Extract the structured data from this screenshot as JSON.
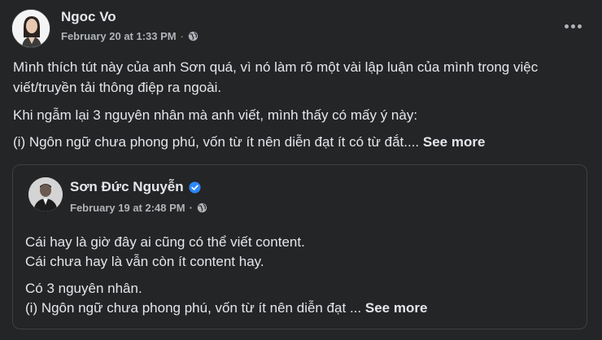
{
  "post": {
    "author": "Ngoc Vo",
    "date": "February 20 at 1:33 PM",
    "separator": "·",
    "privacy_icon": "globe-icon",
    "menu_icon": "more-horizontal-icon",
    "paragraphs": [
      "Mình thích tút này của anh Sơn quá, vì nó làm rõ một vài lập luận của mình trong việc viết/truyền tải thông điệp ra ngoài.",
      "Khi ngẫm lại 3 nguyên nhân mà anh viết, mình thấy có mấy ý này:",
      "(i) Ngôn ngữ chưa phong phú, vốn từ ít nên diễn đạt ít có từ đắt...."
    ],
    "see_more": "See more"
  },
  "shared_post": {
    "author": "Sơn Đức Nguyễn",
    "verified_icon": "verified-badge-icon",
    "date": "February 19 at 2:48 PM",
    "separator": "·",
    "privacy_icon": "globe-icon",
    "lines": [
      "Cái hay là giờ đây ai cũng có thể viết content.",
      "Cái chưa hay là vẫn còn ít content hay.",
      "Có 3 nguyên nhân.",
      "(i) Ngôn ngữ chưa phong phú, vốn từ ít nên diễn đạt ..."
    ],
    "see_more": "See more"
  },
  "colors": {
    "background": "#242526",
    "text_primary": "#e4e6eb",
    "text_secondary": "#b0b3b8",
    "verified_blue": "#2d88ff",
    "border": "#3e4042"
  }
}
